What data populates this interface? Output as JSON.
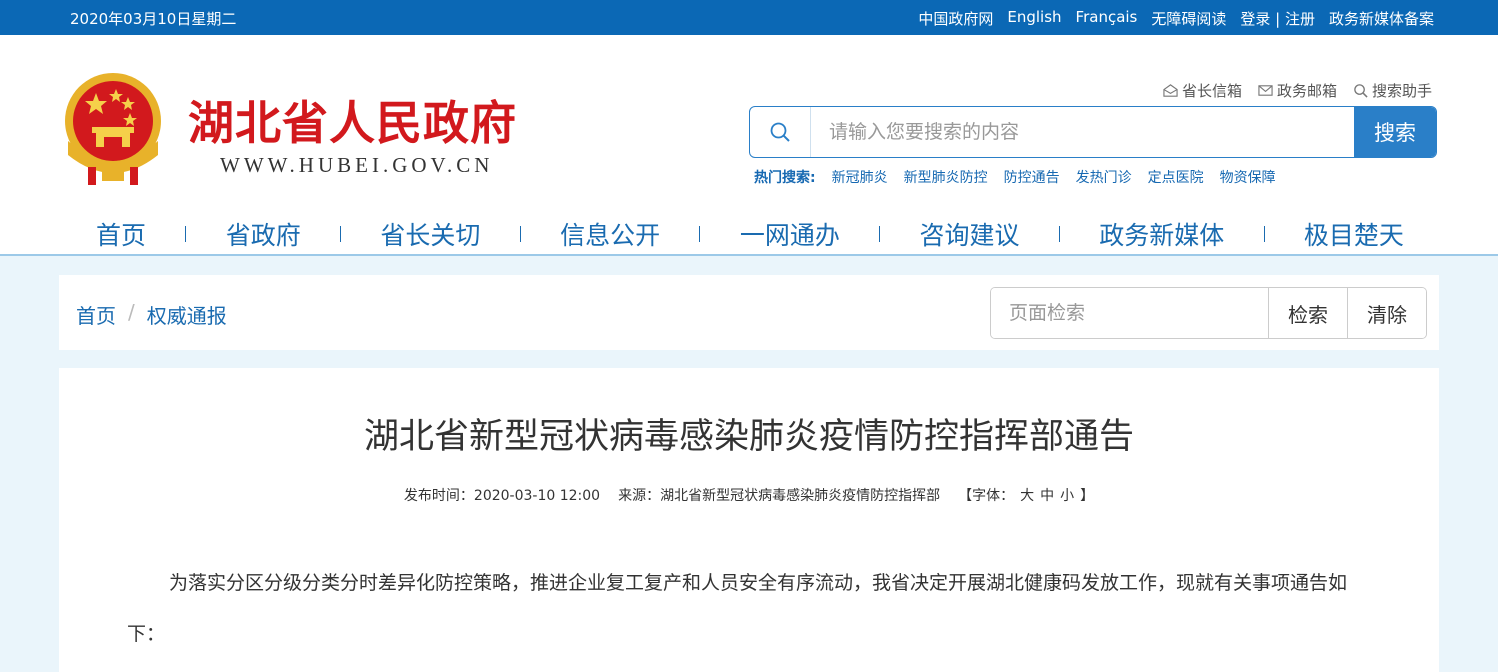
{
  "topbar": {
    "date": "2020年03月10日星期二",
    "links": [
      "中国政府网",
      "English",
      "Français",
      "无障碍阅读",
      "登录 | 注册",
      "政务新媒体备案"
    ]
  },
  "header": {
    "title": "湖北省人民政府",
    "url": "WWW.HUBEI.GOV.CN",
    "tools": [
      "省长信箱",
      "政务邮箱",
      "搜索助手"
    ],
    "search": {
      "placeholder": "请输入您要搜索的内容",
      "button": "搜索"
    },
    "hot_label": "热门搜索:",
    "hot_items": [
      "新冠肺炎",
      "新型肺炎防控",
      "防控通告",
      "发热门诊",
      "定点医院",
      "物资保障"
    ]
  },
  "nav": [
    "首页",
    "省政府",
    "省长关切",
    "信息公开",
    "一网通办",
    "咨询建议",
    "政务新媒体",
    "极目楚天"
  ],
  "breadcrumb": {
    "home": "首页",
    "sep": "/",
    "current": "权威通报"
  },
  "page_search": {
    "placeholder": "页面检索",
    "search_label": "检索",
    "clear_label": "清除"
  },
  "article": {
    "title": "湖北省新型冠状病毒感染肺炎疫情防控指挥部通告",
    "publish_time": "发布时间：2020-03-10 12:00",
    "source": "来源：湖北省新型冠状病毒感染肺炎疫情防控指挥部",
    "font_label": "【字体：",
    "font_sizes": [
      "大",
      "中",
      "小"
    ],
    "font_close": "】",
    "body": "为落实分区分级分类分时差异化防控策略，推进企业复工复产和人员安全有序流动，我省决定开展湖北健康码发放工作，现就有关事项通告如下："
  },
  "colors": {
    "brand_blue": "#0b68b5",
    "title_red": "#d2191d",
    "link_blue": "#1a6bb0"
  }
}
